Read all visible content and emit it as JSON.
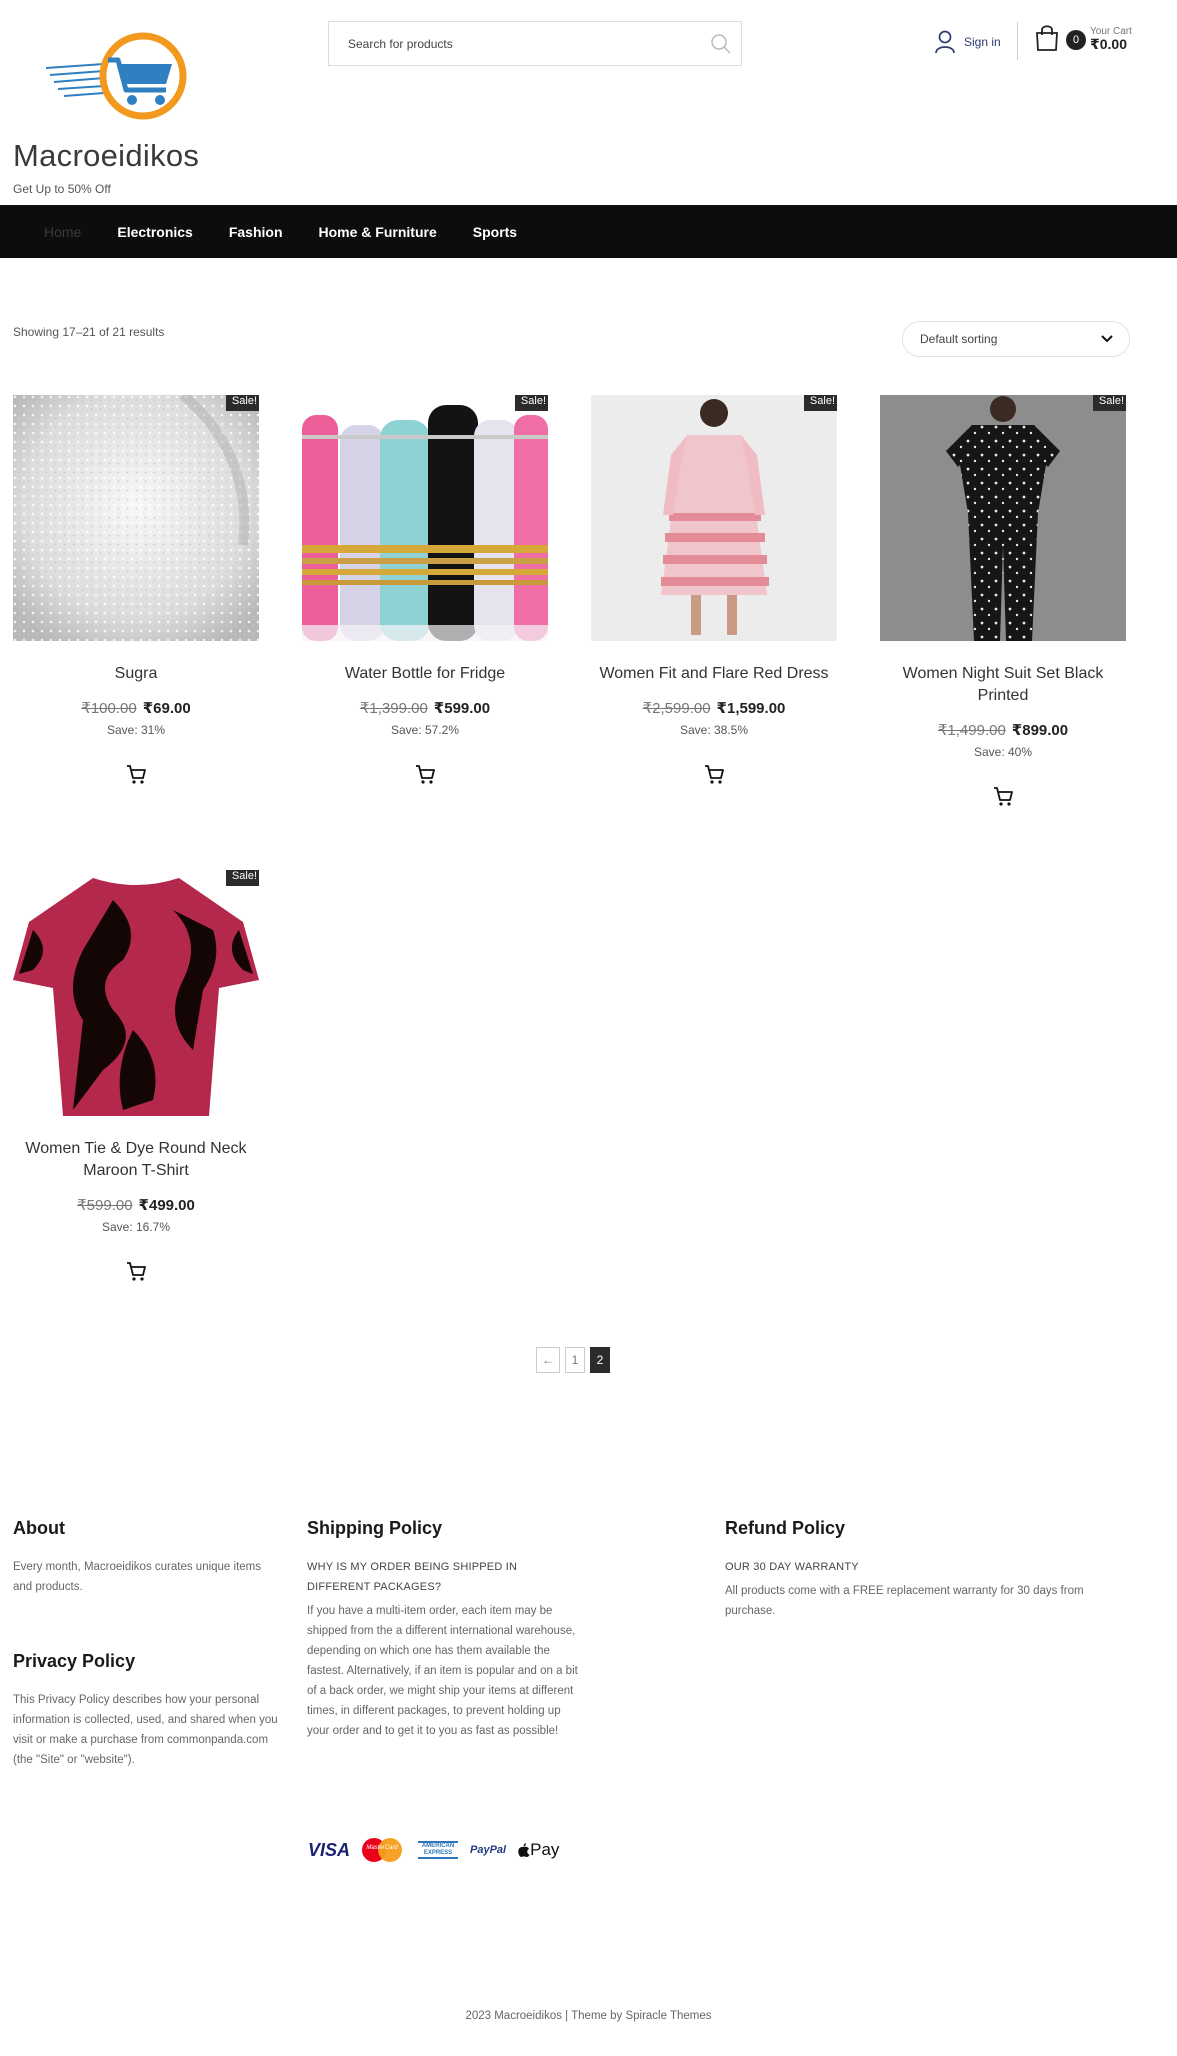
{
  "header": {
    "site_title": "Macroeidikos",
    "tagline": "Get Up to 50% Off",
    "search_placeholder": "Search for products",
    "signin_label": "Sign in",
    "cart_label": "Your Cart",
    "cart_total": "₹0.00",
    "cart_count": "0"
  },
  "nav": {
    "items": [
      "Home",
      "Electronics",
      "Fashion",
      "Home & Furniture",
      "Sports"
    ]
  },
  "toolbar": {
    "results_text": "Showing 17–21 of 21 results",
    "sorting_label": "Default sorting"
  },
  "products": [
    {
      "badge": "Sale!",
      "name": "Sugra",
      "old_price": "₹100.00",
      "new_price": "₹69.00",
      "save": "Save: 31%"
    },
    {
      "badge": "Sale!",
      "name": "Water Bottle for Fridge",
      "old_price": "₹1,399.00",
      "new_price": "₹599.00",
      "save": "Save: 57.2%"
    },
    {
      "badge": "Sale!",
      "name": "Women Fit and Flare Red Dress",
      "old_price": "₹2,599.00",
      "new_price": "₹1,599.00",
      "save": "Save: 38.5%"
    },
    {
      "badge": "Sale!",
      "name": "Women Night Suit Set Black Printed",
      "old_price": "₹1,499.00",
      "new_price": "₹899.00",
      "save": "Save: 40%"
    },
    {
      "badge": "Sale!",
      "name": "Women Tie & Dye Round Neck Maroon T-Shirt",
      "old_price": "₹599.00",
      "new_price": "₹499.00",
      "save": "Save: 16.7%"
    }
  ],
  "pagination": {
    "prev": "←",
    "pages": [
      "1",
      "2"
    ],
    "current": "2"
  },
  "footer": {
    "about": {
      "title": "About",
      "text": "Every month, Macroeidikos curates unique items and products."
    },
    "privacy": {
      "title": "Privacy Policy",
      "text": "This Privacy Policy describes how your personal information is collected, used, and shared when you visit or make a purchase from commonpanda.com (the \"Site\" or \"website\")."
    },
    "shipping": {
      "title": "Shipping Policy",
      "subtitle": "WHY IS MY ORDER BEING SHIPPED IN DIFFERENT PACKAGES?",
      "text": "If you have a multi-item order, each item may be shipped from the a different international warehouse, depending on which one has them available the fastest. Alternatively, if an item is popular and on a bit of a back order, we might ship your items at different times, in different packages, to prevent holding up your order and to get it to you as fast as possible!"
    },
    "refund": {
      "title": "Refund Policy",
      "subtitle": "OUR 30 DAY WARRANTY",
      "text": "All products come with a FREE replacement warranty for 30 days from purchase."
    },
    "payments": {
      "visa": "VISA",
      "mastercard": "MasterCard",
      "amex": "AMERICAN EXPRESS",
      "paypal": "PayPal",
      "applepay": "Pay"
    },
    "copyright": "2023 Macroeidikos | Theme by Spiracle Themes"
  },
  "colors": {
    "nav_bg": "#0d0d0d",
    "logo_orange": "#f39a1e",
    "logo_blue": "#2f7fc1",
    "sale_badge": "#2b2b2b"
  },
  "icons": [
    "logo-cart-icon",
    "search-icon",
    "user-icon",
    "shopping-bag-icon",
    "chevron-down-icon",
    "add-to-cart-icon"
  ]
}
